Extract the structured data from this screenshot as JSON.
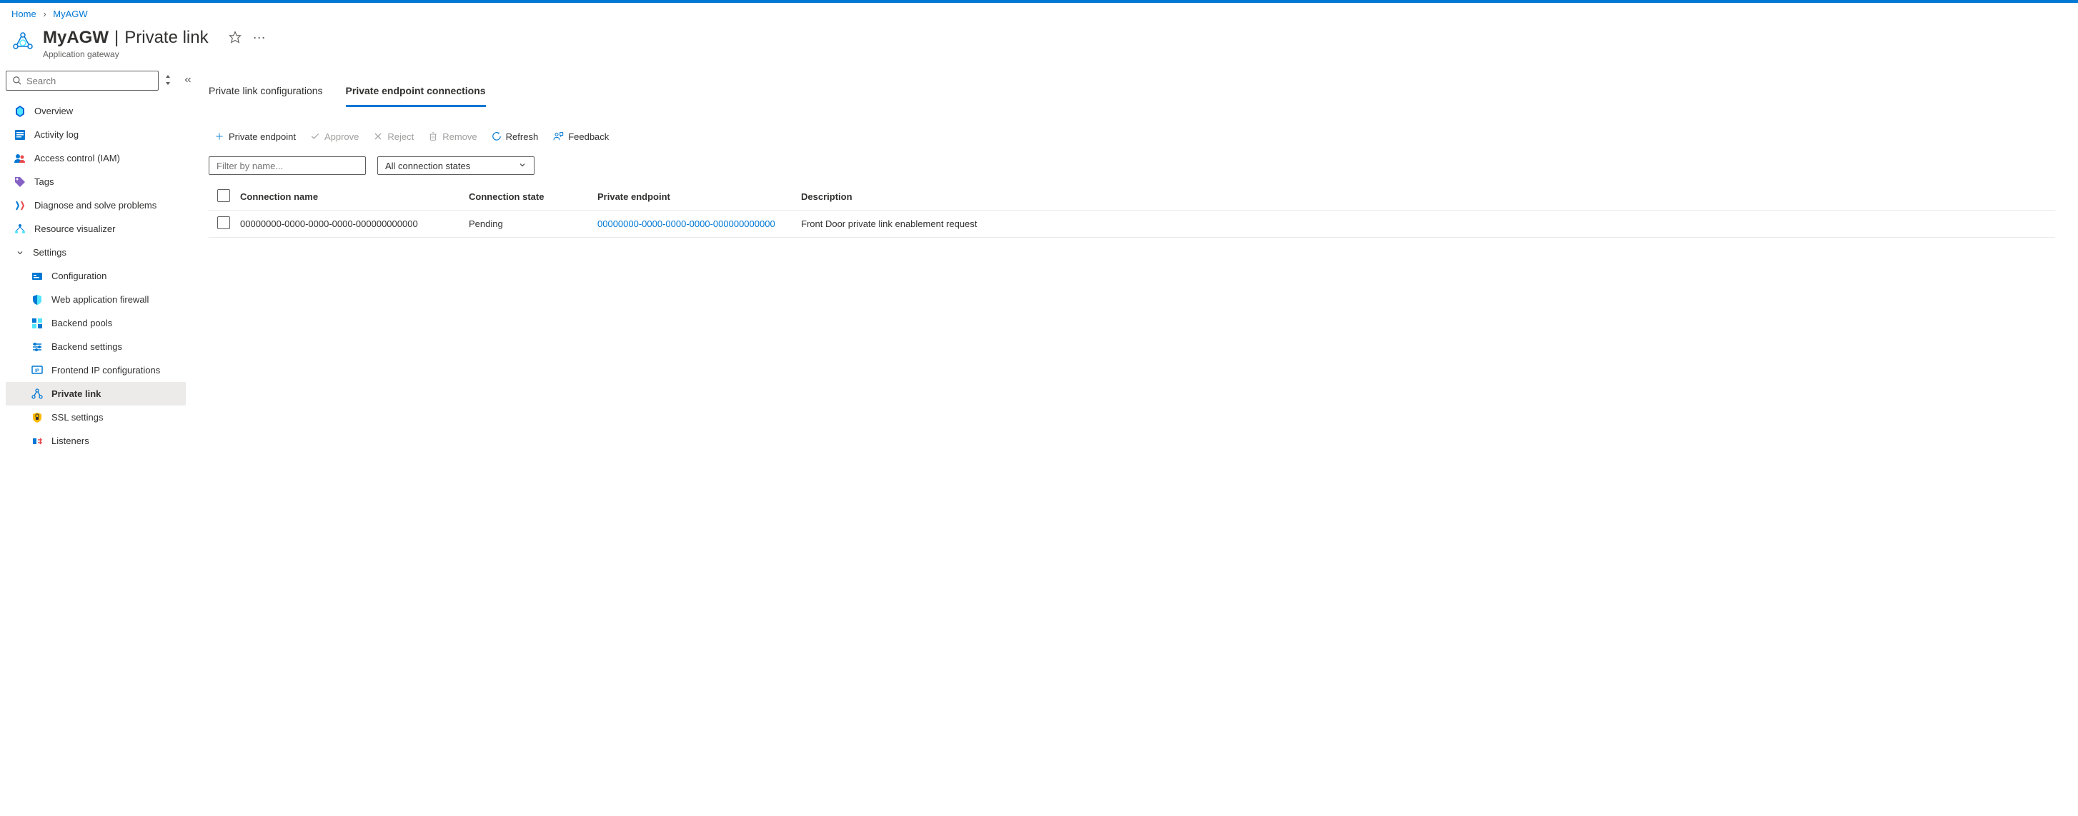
{
  "breadcrumb": {
    "items": [
      "Home",
      "MyAGW"
    ]
  },
  "header": {
    "title_bold": "MyAGW",
    "title_light": "Private link",
    "subtitle": "Application gateway"
  },
  "search": {
    "placeholder": "Search"
  },
  "nav": {
    "overview": "Overview",
    "activity_log": "Activity log",
    "access_control": "Access control (IAM)",
    "tags": "Tags",
    "diagnose": "Diagnose and solve problems",
    "resource_viz": "Resource visualizer",
    "settings": "Settings",
    "configuration": "Configuration",
    "waf": "Web application firewall",
    "backend_pools": "Backend pools",
    "backend_settings": "Backend settings",
    "frontend_ip": "Frontend IP configurations",
    "private_link": "Private link",
    "ssl": "SSL settings",
    "listeners": "Listeners"
  },
  "tabs": {
    "configurations": "Private link configurations",
    "connections": "Private endpoint connections"
  },
  "toolbar": {
    "private_endpoint": "Private endpoint",
    "approve": "Approve",
    "reject": "Reject",
    "remove": "Remove",
    "refresh": "Refresh",
    "feedback": "Feedback"
  },
  "filters": {
    "name_placeholder": "Filter by name...",
    "state_label": "All connection states"
  },
  "table": {
    "headers": {
      "connection_name": "Connection name",
      "connection_state": "Connection state",
      "private_endpoint": "Private endpoint",
      "description": "Description"
    },
    "rows": [
      {
        "name": "00000000-0000-0000-0000-000000000000",
        "state": "Pending",
        "endpoint": "00000000-0000-0000-0000-000000000000",
        "description": "Front Door private link enablement request"
      }
    ]
  }
}
